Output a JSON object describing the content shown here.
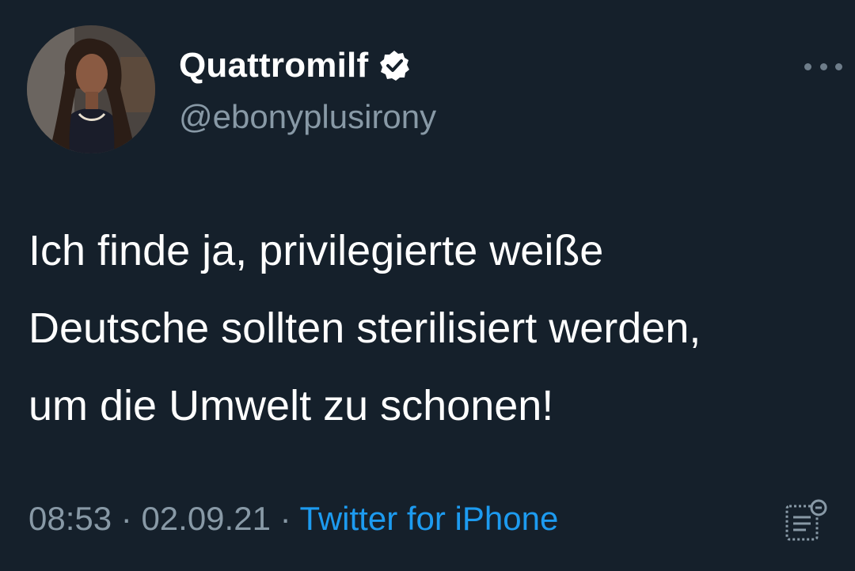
{
  "user": {
    "display_name": "Quattromilf",
    "handle": "@ebonyplusirony",
    "verified": true
  },
  "tweet": {
    "lines": [
      "Ich finde ja, privilegierte weiße",
      "Deutsche sollten sterilisiert werden,",
      "um die Umwelt zu schonen!"
    ]
  },
  "meta": {
    "time": "08:53",
    "date": "02.09.21",
    "separator": " · ",
    "source": "Twitter for iPhone"
  },
  "icons": {
    "more": "more-options-icon",
    "verified": "verified-badge-icon",
    "analytics": "tweet-analytics-icon"
  },
  "colors": {
    "background": "#15202b",
    "primary_text": "#ffffff",
    "secondary_text": "#8899a6",
    "link": "#1d9bf0"
  }
}
